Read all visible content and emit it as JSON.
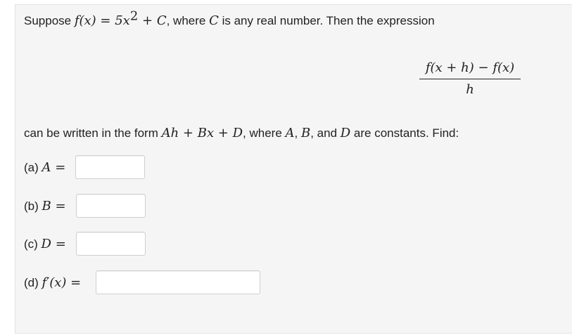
{
  "problem": {
    "intro_prefix": "Suppose ",
    "intro_function": "f(x) = 5x",
    "intro_exponent": "2",
    "intro_plus_c": " + C",
    "intro_where": ", where ",
    "intro_c": "C",
    "intro_suffix": " is any real number. Then the expression",
    "fraction_numerator": "f(x + h) − f(x)",
    "fraction_denominator": "h",
    "form_prefix": "can be written in the form ",
    "form_expr": "Ah + Bx + D",
    "form_where": ", where ",
    "const_a": "A",
    "comma1": ", ",
    "const_b": "B",
    "and_text": ", and ",
    "const_d": "D",
    "form_suffix": " are constants. Find:"
  },
  "questions": [
    {
      "label": "(a) ",
      "symbol": "A",
      "equals": " =",
      "value": ""
    },
    {
      "label": "(b) ",
      "symbol": "B",
      "equals": " =",
      "value": ""
    },
    {
      "label": "(c) ",
      "symbol": "D",
      "equals": " =",
      "value": ""
    },
    {
      "label": "(d) ",
      "symbol": "f′(x)",
      "equals": " =",
      "value": ""
    }
  ]
}
